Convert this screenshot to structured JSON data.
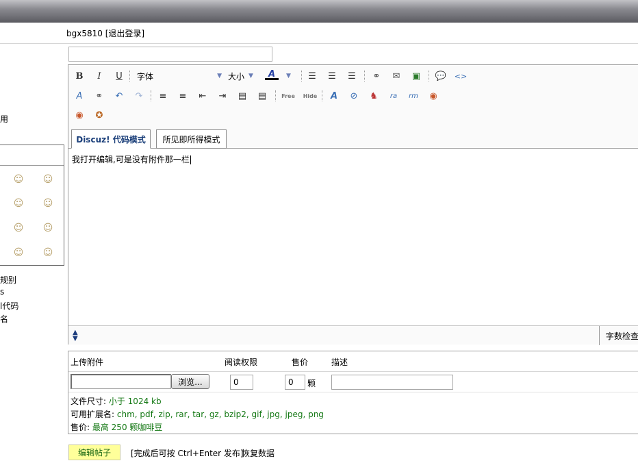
{
  "header": {
    "username": "bgx5810",
    "logout": "[退出登录]"
  },
  "sidebar": {
    "item_top": "用",
    "links": [
      "规别",
      "s",
      "l代码",
      "名"
    ]
  },
  "editor": {
    "font_label": "字体",
    "size_label": "大小",
    "tabs": [
      "Discuz! 代码模式",
      "所见即所得模式"
    ],
    "content": "我打开编辑,可是没有附件那一栏",
    "word_check": "字数检查",
    "free_label": "Free",
    "hide_label": "Hide"
  },
  "attachments": {
    "headers": [
      "上传附件",
      "阅读权限",
      "售价",
      "描述"
    ],
    "browse": "浏览...",
    "read_perm_value": "0",
    "price_value": "0",
    "price_unit": "颗",
    "size_label": "文件尺寸: ",
    "size_value": "小于 1024 kb",
    "ext_label": "可用扩展名: ",
    "ext_value": "chm, pdf, zip, rar, tar, gz, bzip2, gif, jpg, jpeg, png",
    "price_label": "售价: ",
    "price_note": "最高 250 颗咖啡豆"
  },
  "footer": {
    "submit": "编辑帖子",
    "hint": "[完成后可按 Ctrl+Enter 发布]",
    "restore": "恢复数据"
  }
}
